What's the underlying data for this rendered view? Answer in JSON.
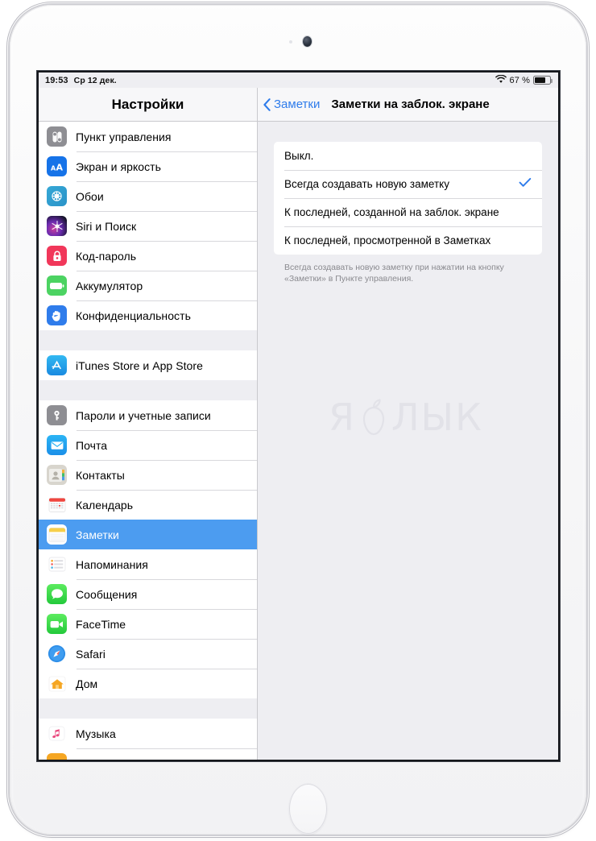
{
  "statusbar": {
    "time": "19:53",
    "date": "Ср 12 дек.",
    "battery_percent": "67 %",
    "wifi_icon": "wifi-icon",
    "battery_icon": "battery-icon"
  },
  "sidebar": {
    "title": "Настройки",
    "groups": [
      {
        "items": [
          {
            "label": "Пункт управления",
            "icon": "control-center-icon"
          },
          {
            "label": "Экран и яркость",
            "icon": "display-brightness-icon"
          },
          {
            "label": "Обои",
            "icon": "wallpaper-icon"
          },
          {
            "label": "Siri и Поиск",
            "icon": "siri-search-icon"
          },
          {
            "label": "Код-пароль",
            "icon": "passcode-lock-icon"
          },
          {
            "label": "Аккумулятор",
            "icon": "battery-icon"
          },
          {
            "label": "Конфиденциальность",
            "icon": "privacy-hand-icon"
          }
        ]
      },
      {
        "items": [
          {
            "label": "iTunes Store и App Store",
            "icon": "app-store-icon"
          }
        ]
      },
      {
        "items": [
          {
            "label": "Пароли и учетные записи",
            "icon": "passwords-key-icon"
          },
          {
            "label": "Почта",
            "icon": "mail-icon"
          },
          {
            "label": "Контакты",
            "icon": "contacts-icon"
          },
          {
            "label": "Календарь",
            "icon": "calendar-icon"
          },
          {
            "label": "Заметки",
            "icon": "notes-icon",
            "selected": true
          },
          {
            "label": "Напоминания",
            "icon": "reminders-icon"
          },
          {
            "label": "Сообщения",
            "icon": "messages-icon"
          },
          {
            "label": "FaceTime",
            "icon": "facetime-icon"
          },
          {
            "label": "Safari",
            "icon": "safari-icon"
          },
          {
            "label": "Дом",
            "icon": "home-icon"
          }
        ]
      },
      {
        "items": [
          {
            "label": "Музыка",
            "icon": "music-icon"
          }
        ]
      }
    ]
  },
  "detail": {
    "back_label": "Заметки",
    "back_icon": "chevron-left-icon",
    "title": "Заметки на заблок. экране",
    "options": [
      {
        "label": "Выкл.",
        "checked": false
      },
      {
        "label": "Всегда создавать новую заметку",
        "checked": true
      },
      {
        "label": "К последней, созданной на заблок. экране",
        "checked": false
      },
      {
        "label": "К последней, просмотренной в Заметках",
        "checked": false
      }
    ],
    "check_icon": "checkmark-icon",
    "footnote": "Всегда создавать новую заметку при нажатии на кнопку «Заметки» в Пункте управления."
  },
  "watermark": {
    "text_before": "Я",
    "apple_icon": "apple-logo-icon",
    "text_after": "ЛЫК"
  },
  "device": {
    "camera_icon": "front-camera-icon",
    "home_button": "home-button"
  },
  "colors": {
    "accent_blue": "#2f7ceb",
    "selection_blue": "#4c9cf0",
    "screen_bg": "#eeeef2",
    "row_bg": "#ffffff",
    "separator": "#d8d8dc",
    "footnote_gray": "#8a8a8f"
  }
}
